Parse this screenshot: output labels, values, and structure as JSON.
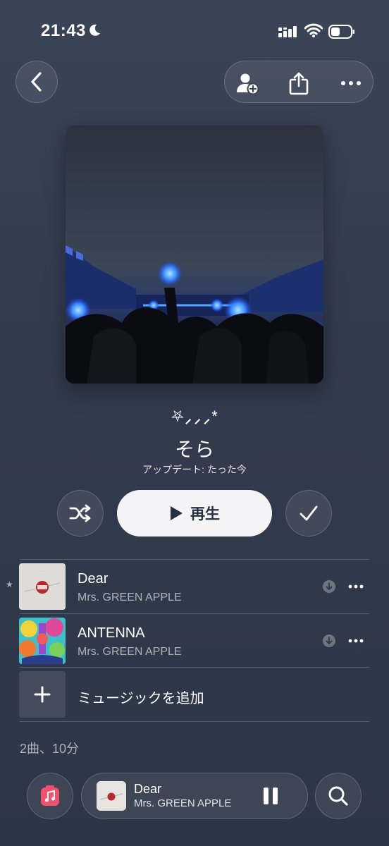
{
  "status_bar": {
    "time": "21:43",
    "icons": [
      "moon-icon",
      "cellular-signal-icon",
      "wifi-icon",
      "battery-icon"
    ]
  },
  "nav": {
    "icons": [
      "chevron-left-icon",
      "add-person-icon",
      "share-icon",
      "more-icon"
    ]
  },
  "playlist": {
    "decoration": "⛧⸝⸝⸝*",
    "title": "そら",
    "updated": "アップデート: たった今",
    "play_label": "再生"
  },
  "tracks": [
    {
      "title": "Dear",
      "artist": "Mrs. GREEN APPLE",
      "marker": "★"
    },
    {
      "title": "ANTENNA",
      "artist": "Mrs. GREEN APPLE",
      "marker": ""
    }
  ],
  "add_music_label": "ミュージックを追加",
  "summary": "2曲、10分",
  "now_playing": {
    "title": "Dear",
    "artist": "Mrs. GREEN APPLE"
  },
  "colors": {
    "background": "#333c4e",
    "play_button": "#f4f4f6",
    "music_app_pink": "#f2506b"
  }
}
